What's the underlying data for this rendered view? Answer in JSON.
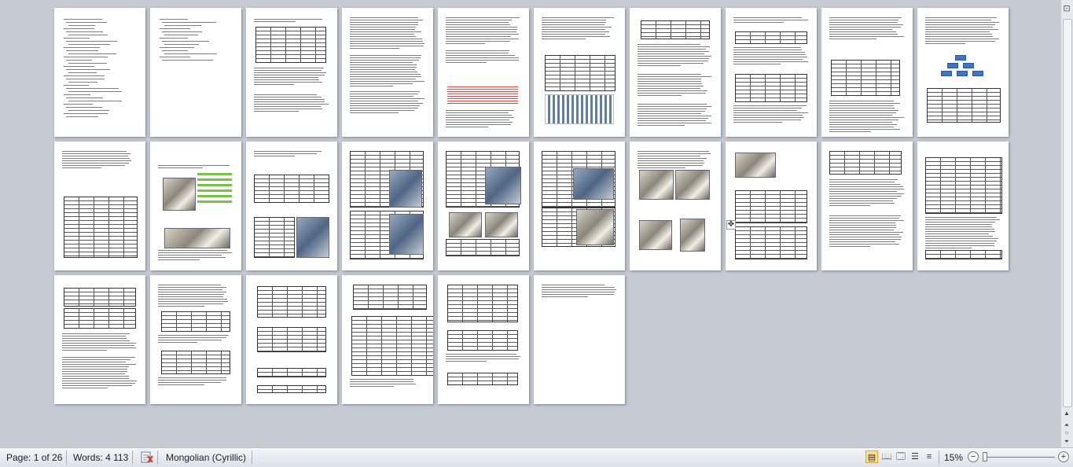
{
  "status_bar": {
    "page_info": "Page: 1 of 26",
    "word_count": "Words: 4 113",
    "language": "Mongolian (Cyrillic)",
    "zoom_level": "15%"
  },
  "icons": {
    "spelling": "spell-check-icon",
    "print_layout": "print-layout-icon",
    "full_screen_reading": "full-screen-reading-icon",
    "web_layout": "web-layout-icon",
    "outline": "outline-icon",
    "draft": "draft-icon",
    "zoom_out": "zoom-out-icon",
    "zoom_in": "zoom-in-icon",
    "move_handle": "move-handle-icon"
  },
  "colors": {
    "workspace": "#c5cad3",
    "statusbar": "#dce2ea",
    "active_view": "#ffe28a"
  }
}
